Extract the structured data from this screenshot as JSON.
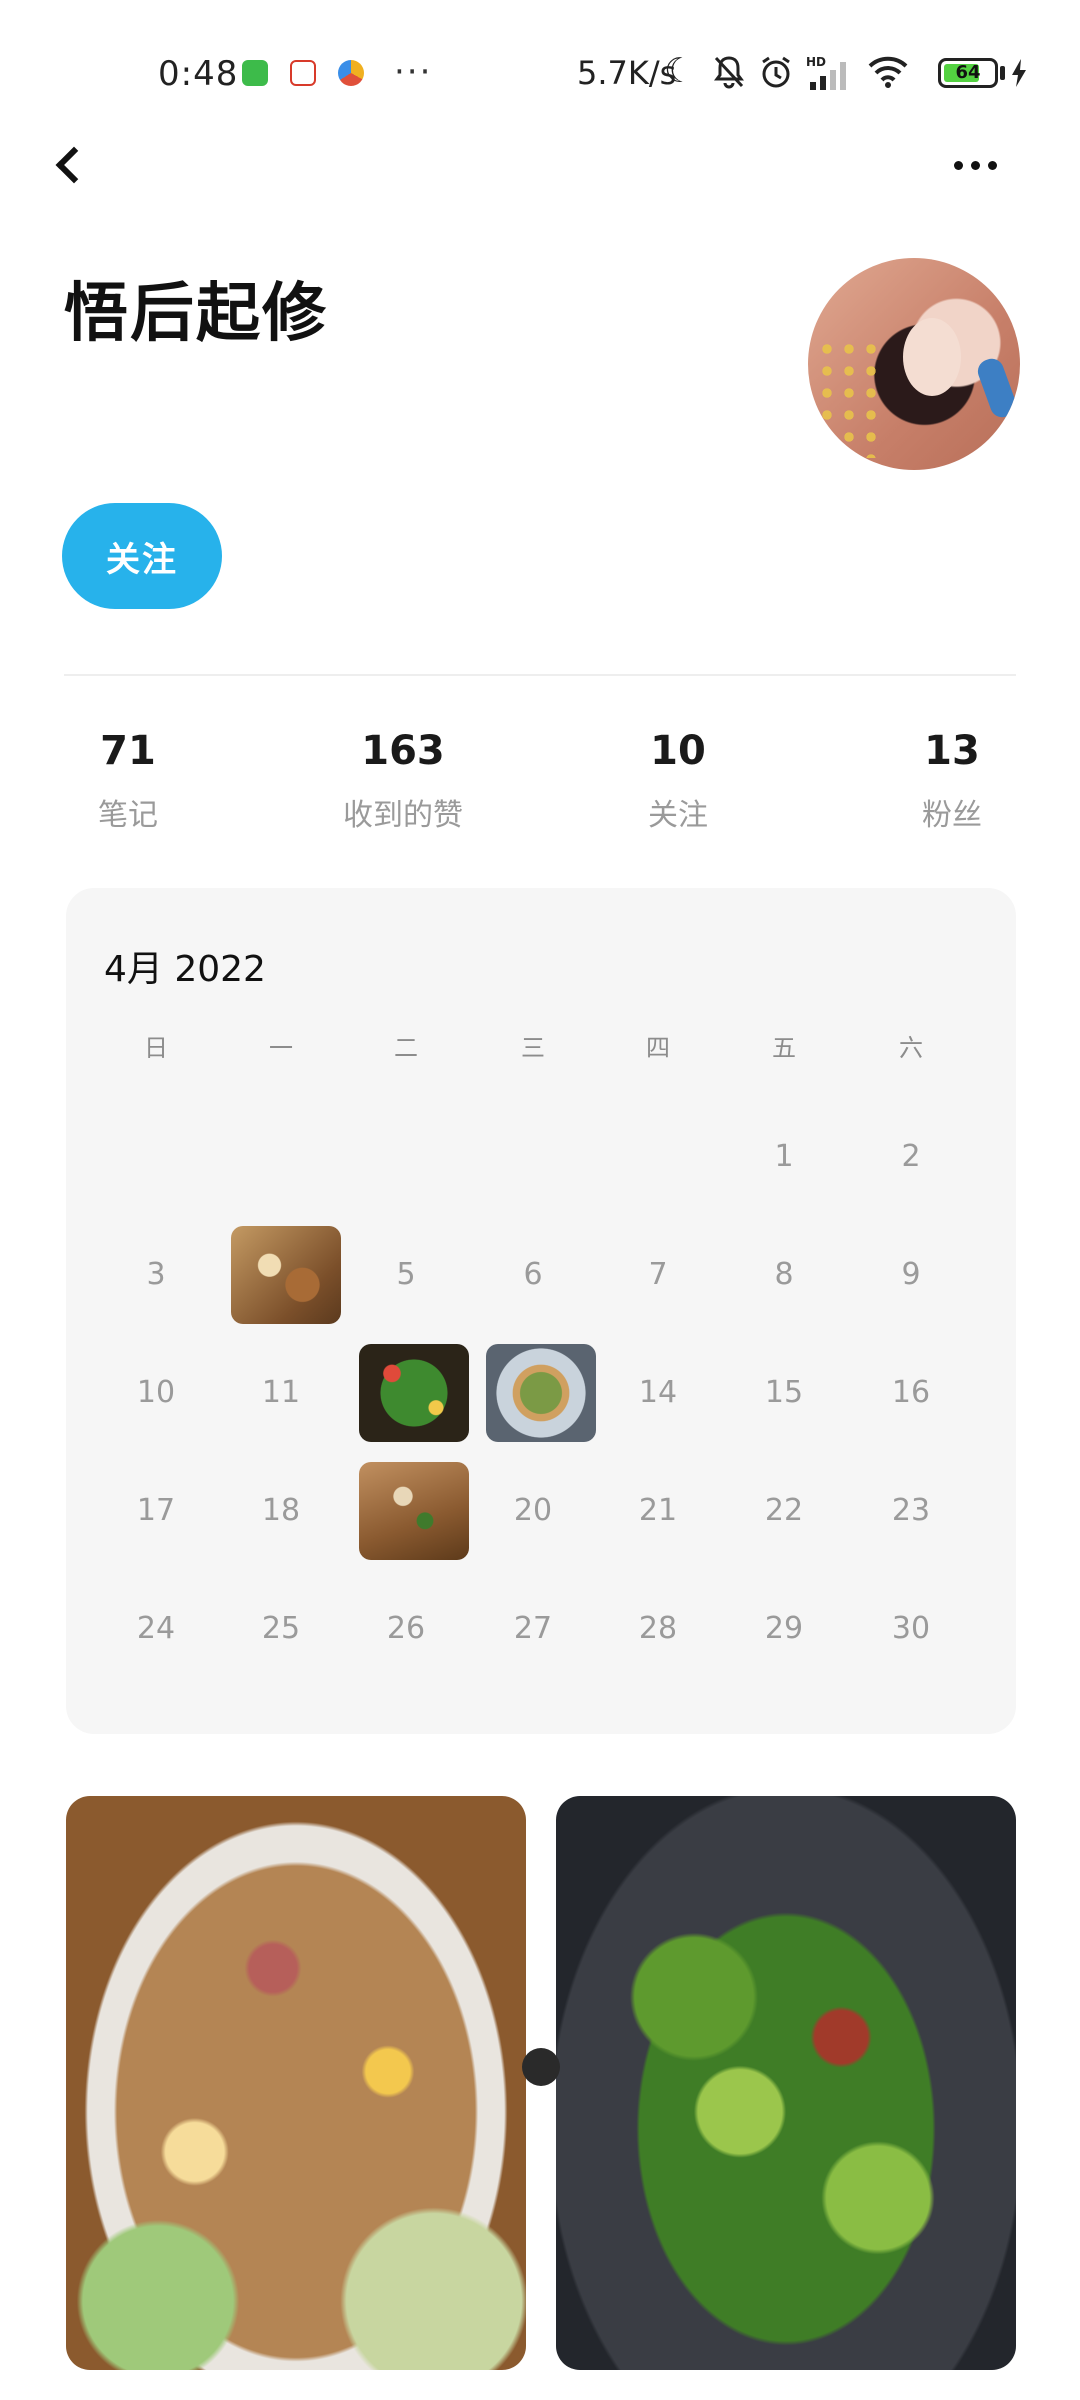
{
  "status_bar": {
    "time": "0:48",
    "dots": "···",
    "speed": "5.7K/s",
    "hd_label": "HD",
    "battery": "64",
    "icons": [
      "moon-icon",
      "bell-off-icon",
      "alarm-icon",
      "signal-icon",
      "wifi-icon",
      "battery-icon",
      "charging-icon"
    ]
  },
  "nav": {
    "back_icon": "back-chevron-icon",
    "more_icon": "more-horizontal-icon"
  },
  "profile": {
    "name": "悟后起修",
    "follow_label": "关注"
  },
  "stats": [
    {
      "value": "71",
      "label": "笔记"
    },
    {
      "value": "163",
      "label": "收到的赞"
    },
    {
      "value": "10",
      "label": "关注"
    },
    {
      "value": "13",
      "label": "粉丝"
    }
  ],
  "calendar": {
    "title": "4月 2022",
    "weekdays": [
      "日",
      "一",
      "二",
      "三",
      "四",
      "五",
      "六"
    ],
    "days": {
      "d1": "1",
      "d2": "2",
      "d3": "3",
      "d5": "5",
      "d6": "6",
      "d7": "7",
      "d8": "8",
      "d9": "9",
      "d10": "10",
      "d11": "11",
      "d14": "14",
      "d15": "15",
      "d16": "16",
      "d17": "17",
      "d18": "18",
      "d20": "20",
      "d21": "21",
      "d22": "22",
      "d23": "23",
      "d24": "24",
      "d25": "25",
      "d26": "26",
      "d27": "27",
      "d28": "28",
      "d29": "29",
      "d30": "30"
    },
    "photo_days": [
      "4",
      "12",
      "13",
      "19"
    ]
  },
  "colors": {
    "accent": "#27b2eb",
    "calendar_bg": "#f6f6f6",
    "muted_text": "#9a9a9a"
  }
}
